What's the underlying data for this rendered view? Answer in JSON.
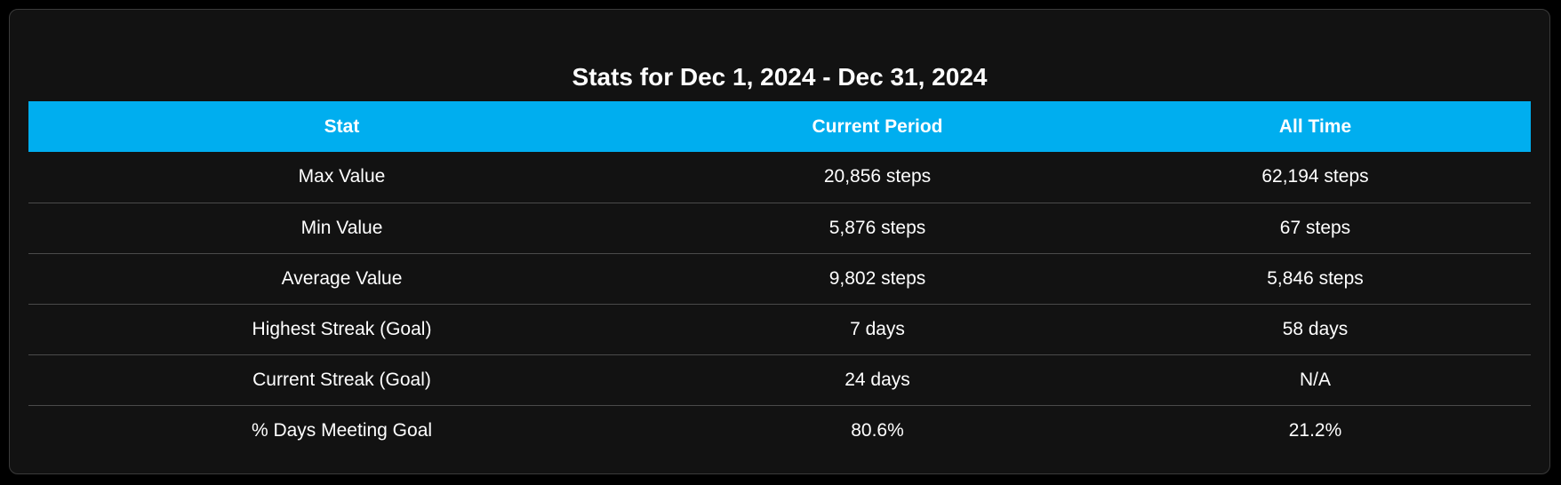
{
  "title": "Stats for Dec 1, 2024 - Dec 31, 2024",
  "colors": {
    "header_background": "#00aeef",
    "panel_background": "#121212",
    "text": "#ffffff"
  },
  "table": {
    "headers": [
      "Stat",
      "Current Period",
      "All Time"
    ],
    "rows": [
      [
        "Max Value",
        "20,856 steps",
        "62,194 steps"
      ],
      [
        "Min Value",
        "5,876 steps",
        "67 steps"
      ],
      [
        "Average Value",
        "9,802 steps",
        "5,846 steps"
      ],
      [
        "Highest Streak (Goal)",
        "7 days",
        "58 days"
      ],
      [
        "Current Streak (Goal)",
        "24 days",
        "N/A"
      ],
      [
        "% Days Meeting Goal",
        "80.6%",
        "21.2%"
      ]
    ]
  }
}
